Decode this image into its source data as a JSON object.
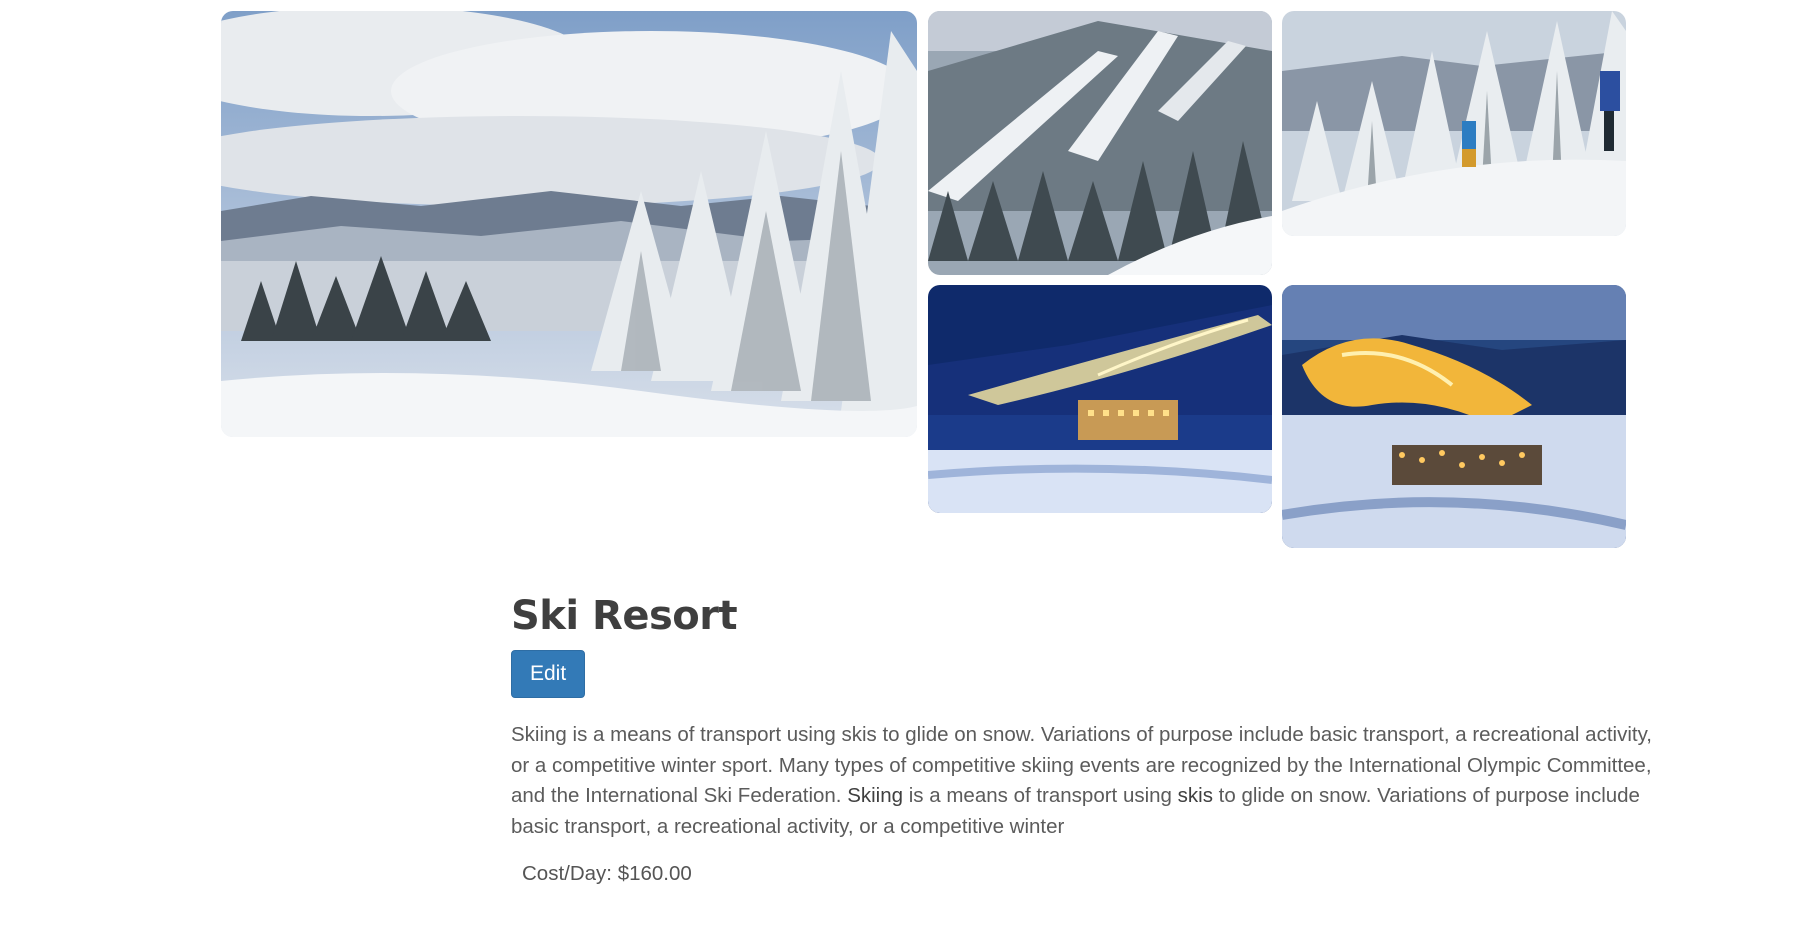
{
  "gallery": {
    "main_alt": "Snowy mountain valley with snow-covered fir trees",
    "img2_alt": "Ski slopes through snowy forest",
    "img3_alt": "Skiers among snow-covered trees",
    "img4_alt": "Ski resort lit up at night",
    "img5_alt": "Illuminated ski slopes and village at night"
  },
  "resort": {
    "title": "Ski Resort",
    "edit_label": "Edit",
    "description_part1": " Skiing is a means of transport using skis to glide on snow. Variations of purpose include basic transport, a recreational activity, or a competitive winter sport. Many types of competitive skiing events are recognized by the International Olympic Committee, and the International Ski Federation.  ",
    "description_term1": "Skiing",
    "description_part2": " is a means of transport using ",
    "description_term2": "skis",
    "description_part3": " to glide on snow. Variations of purpose include basic transport, a recreational activity, or a competitive winter",
    "cost_label": "Cost/Day: $160.00"
  },
  "colors": {
    "accent": "#337ab7",
    "title": "#3f3f3f",
    "text": "#5b5b5b"
  }
}
